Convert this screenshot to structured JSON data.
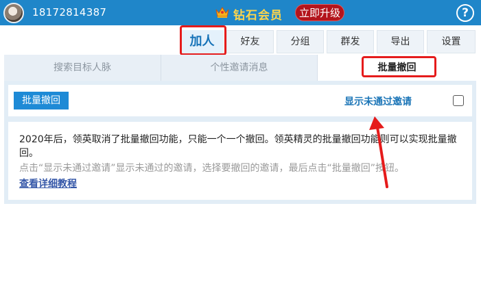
{
  "header": {
    "phone": "18172814387",
    "vip_label": "钻石会员",
    "upgrade_label": "立即升级",
    "help_label": "?"
  },
  "colors": {
    "header_bg": "#1f86c9",
    "accent": "#1e8ad6",
    "vip_gold": "#ffd54a",
    "upgrade_red": "#b3141c",
    "highlight_red": "#e51b1b"
  },
  "top_tabs": [
    {
      "label": "加人",
      "active": true
    },
    {
      "label": "好友",
      "active": false
    },
    {
      "label": "分组",
      "active": false
    },
    {
      "label": "群发",
      "active": false
    },
    {
      "label": "导出",
      "active": false
    },
    {
      "label": "设置",
      "active": false
    }
  ],
  "sub_tabs": [
    {
      "label": "搜索目标人脉",
      "active": false
    },
    {
      "label": "个性邀请消息",
      "active": false
    },
    {
      "label": "批量撤回",
      "active": true
    }
  ],
  "toolbar": {
    "bulk_button": "批量撤回",
    "show_pending_label": "显示未通过邀请",
    "show_pending_checked": false
  },
  "info": {
    "line1": "2020年后，领英取消了批量撤回功能，只能一个一个撤回。领英精灵的批量撤回功能则可以实现批量撤回。",
    "line2": "点击“显示未通过邀请”显示未通过的邀请，选择要撤回的邀请，最后点击“批量撤回”按钮。",
    "link": "查看详细教程"
  }
}
